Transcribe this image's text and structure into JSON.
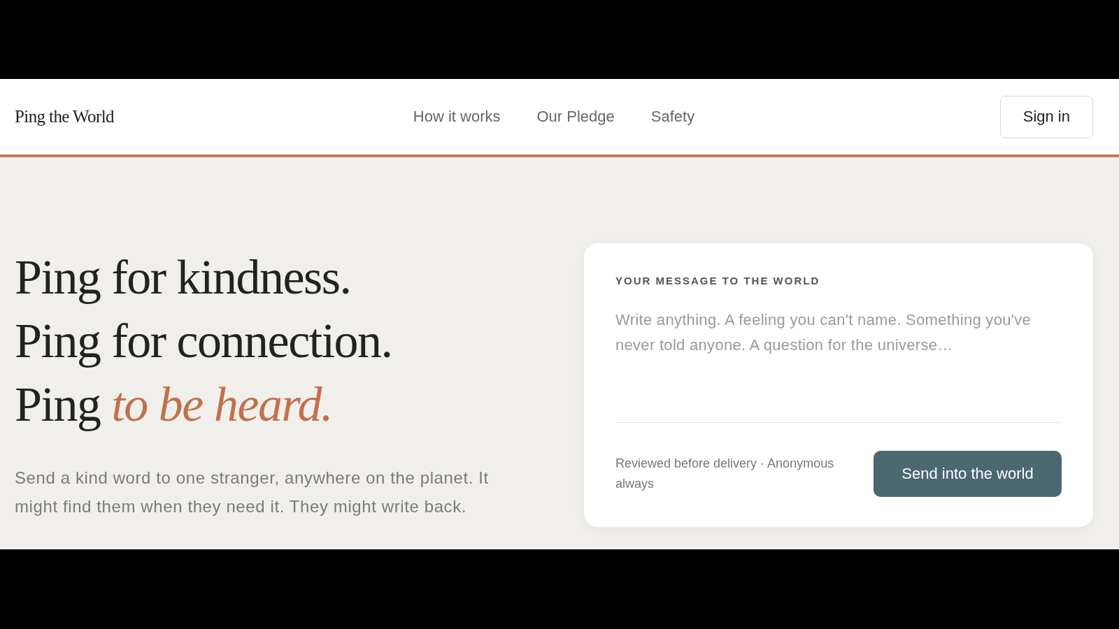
{
  "nav": {
    "logo": "Ping the World",
    "links": [
      {
        "label": "How it works"
      },
      {
        "label": "Our Pledge"
      },
      {
        "label": "Safety"
      }
    ],
    "sign_in": "Sign in"
  },
  "hero": {
    "headline": [
      "Ping for kindness.",
      "Ping for connection.",
      "Ping *to be heard.*"
    ],
    "subtitle": "Send a kind word to one stranger, anywhere on the planet. It might find them when they need it. They might write back."
  },
  "composer": {
    "label": "YOUR MESSAGE TO THE WORLD",
    "placeholder": "Write anything. A feeling you can't name. Something you've never told anyone. A question for the universe…",
    "note": "Reviewed before delivery · Anonymous always",
    "submit": "Send into the world"
  }
}
